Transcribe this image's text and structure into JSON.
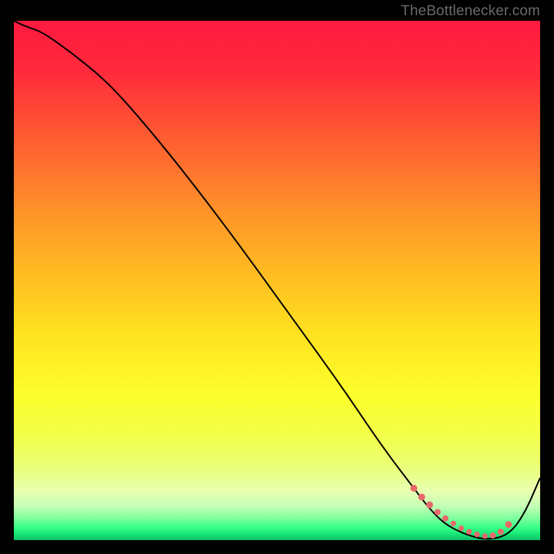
{
  "watermark": "TheBottlenecker.com",
  "chart_data": {
    "type": "line",
    "title": "",
    "xlabel": "",
    "ylabel": "",
    "xlim": [
      0,
      100
    ],
    "ylim": [
      0,
      100
    ],
    "grid": false,
    "background_gradient": {
      "stops": [
        {
          "offset": 0.0,
          "color": "#ff193f"
        },
        {
          "offset": 0.1,
          "color": "#ff2b3b"
        },
        {
          "offset": 0.22,
          "color": "#ff5a32"
        },
        {
          "offset": 0.35,
          "color": "#ff8c2a"
        },
        {
          "offset": 0.48,
          "color": "#ffba22"
        },
        {
          "offset": 0.6,
          "color": "#ffe11f"
        },
        {
          "offset": 0.72,
          "color": "#fcff2c"
        },
        {
          "offset": 0.8,
          "color": "#f2ff4a"
        },
        {
          "offset": 0.86,
          "color": "#eaff78"
        },
        {
          "offset": 0.905,
          "color": "#e9ffb0"
        },
        {
          "offset": 0.935,
          "color": "#c3ffb6"
        },
        {
          "offset": 0.958,
          "color": "#7dff9d"
        },
        {
          "offset": 0.975,
          "color": "#3bff88"
        },
        {
          "offset": 0.988,
          "color": "#17e877"
        },
        {
          "offset": 1.0,
          "color": "#0fbf68"
        }
      ]
    },
    "series": [
      {
        "name": "bottleneck-curve",
        "color": "#000000",
        "x": [
          0,
          2,
          5,
          8,
          12,
          18,
          25,
          33,
          42,
          52,
          62,
          70,
          76,
          79,
          82,
          86,
          90,
          94,
          97,
          100
        ],
        "y": [
          100,
          99,
          98,
          96,
          93,
          88,
          80,
          70,
          58,
          44,
          30,
          18,
          10,
          6,
          3,
          1,
          0,
          1,
          5,
          12
        ]
      }
    ],
    "highlight_points": {
      "name": "selected-range-dots",
      "color": "#e76a6a",
      "x": [
        76,
        77.5,
        79,
        80.5,
        82,
        83.5,
        85,
        86.5,
        88,
        89.5,
        91,
        92.5,
        94
      ],
      "y": [
        10,
        8.3,
        6.8,
        5.4,
        4.2,
        3.2,
        2.3,
        1.6,
        1.1,
        0.8,
        0.9,
        1.6,
        3.0
      ],
      "r": [
        5,
        5,
        5,
        4.5,
        4.5,
        4,
        4,
        4,
        4,
        4,
        4.5,
        4.5,
        5
      ]
    }
  }
}
